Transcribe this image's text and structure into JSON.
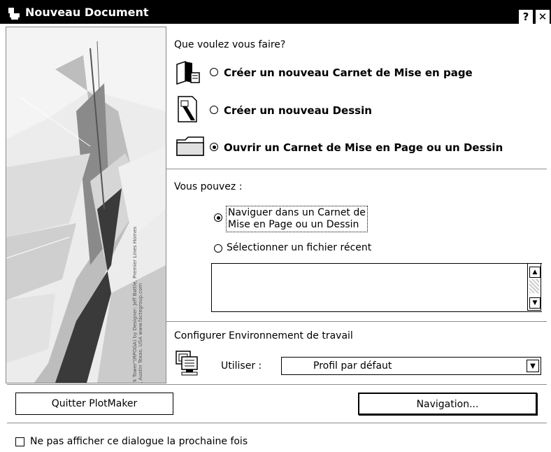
{
  "window": {
    "title": "Nouveau Document",
    "help_button": "?",
    "close_button": "✕"
  },
  "side_image": {
    "credit_text": "\"Tark Tower\"(RPOGA) by Designer: Jeff Battle, Premier Lines Homes Lrd, Austin Texas. USA www.factegroup.com"
  },
  "action_section": {
    "header": "Que voulez vous faire?",
    "options": [
      {
        "label": "Créer un nouveau Carnet de Mise en page",
        "selected": false,
        "icon": "layout-book-icon"
      },
      {
        "label": "Créer un nouveau Dessin",
        "selected": false,
        "icon": "drawing-document-icon"
      },
      {
        "label": "Ouvrir un Carnet de Mise en Page ou un Dessin",
        "selected": true,
        "icon": "open-folder-icon"
      }
    ]
  },
  "can_section": {
    "header": "Vous pouvez :",
    "options": [
      {
        "label_line1": "Naviguer dans un Carnet de",
        "label_line2": "Mise en Page ou un Dessin",
        "selected": true
      },
      {
        "label": "Sélectionner un fichier récent",
        "selected": false
      }
    ]
  },
  "env_section": {
    "header": "Configurer Environnement de travail",
    "use_label": "Utiliser :",
    "profile_value": "Profil par défaut"
  },
  "buttons": {
    "quit": "Quitter PlotMaker",
    "navigation": "Navigation..."
  },
  "footer": {
    "checkbox_label": "Ne pas afficher ce dialogue la prochaine fois",
    "checked": false
  }
}
